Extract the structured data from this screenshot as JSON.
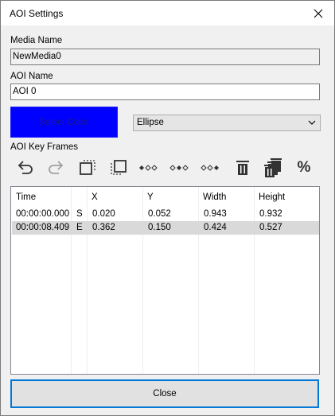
{
  "window": {
    "title": "AOI Settings"
  },
  "media": {
    "label": "Media Name",
    "value": "NewMedia0"
  },
  "aoi": {
    "label": "AOI Name",
    "value": "AOI 0"
  },
  "color": {
    "label": "Select Color",
    "value": "#0000ff"
  },
  "shape": {
    "selected": "Ellipse"
  },
  "keyframes": {
    "label": "AOI Key Frames",
    "toolbar": [
      {
        "name": "undo-icon"
      },
      {
        "name": "redo-icon"
      },
      {
        "name": "copy-frame-icon"
      },
      {
        "name": "paste-frame-icon"
      },
      {
        "name": "first-keyframe-icon"
      },
      {
        "name": "middle-keyframe-icon"
      },
      {
        "name": "last-keyframe-icon"
      },
      {
        "name": "delete-icon"
      },
      {
        "name": "delete-all-icon"
      },
      {
        "name": "percent-icon",
        "glyph": "%"
      }
    ],
    "columns": [
      "Time",
      "",
      "X",
      "Y",
      "Width",
      "Height"
    ],
    "rows": [
      {
        "time": "00:00:00.000",
        "flag": "S",
        "x": "0.020",
        "y": "0.052",
        "width": "0.943",
        "height": "0.932",
        "selected": false
      },
      {
        "time": "00:00:08.409",
        "flag": "E",
        "x": "0.362",
        "y": "0.150",
        "width": "0.424",
        "height": "0.527",
        "selected": true
      }
    ]
  },
  "footer": {
    "close_label": "Close"
  }
}
